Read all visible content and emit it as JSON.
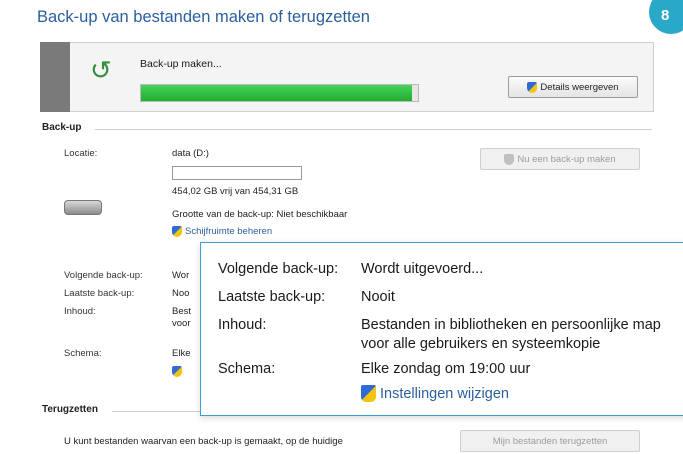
{
  "window": {
    "title": "Back-up van bestanden maken of terugzetten"
  },
  "badge": {
    "number": "8",
    "color": "#2aa8c8"
  },
  "progress": {
    "label": "Back-up maken...",
    "fill_fraction": 0.98,
    "details_button": "Details weergeven"
  },
  "backup_section": {
    "heading": "Back-up",
    "location_label": "Locatie:",
    "location_value": "data (D:)",
    "space_text": "454,02 GB vrij van 454,31 GB",
    "size_text": "Grootte van de back-up: Niet beschikbaar",
    "manage_space_link": "Schijfruimte beheren",
    "backup_now_button": "Nu een back-up maken",
    "next_label": "Volgende back-up:",
    "next_value_partial": "Wor",
    "last_label": "Laatste back-up:",
    "last_value_partial": "Noo",
    "content_label": "Inhoud:",
    "content_value_partial_1": "Best",
    "content_value_partial_2": "voor",
    "schedule_label": "Schema:",
    "schedule_value_partial": "Elke"
  },
  "overlay": {
    "next_label": "Volgende back-up:",
    "next_value": "Wordt uitgevoerd...",
    "last_label": "Laatste back-up:",
    "last_value": "Nooit",
    "content_label": "Inhoud:",
    "content_value_line1": "Bestanden in bibliotheken en persoonlijke map",
    "content_value_line2": "voor alle gebruikers en systeemkopie",
    "schedule_label": "Schema:",
    "schedule_value": "Elke zondag om 19:00 uur",
    "settings_link": "Instellingen wijzigen"
  },
  "restore_section": {
    "heading": "Terugzetten",
    "text": "U kunt bestanden waarvan een back-up is gemaakt, op de huidige",
    "restore_button": "Mijn bestanden terugzetten"
  },
  "colors": {
    "accent": "#2a5f9e",
    "progress": "#1fae2f",
    "overlay_border": "#3c9fd4"
  }
}
